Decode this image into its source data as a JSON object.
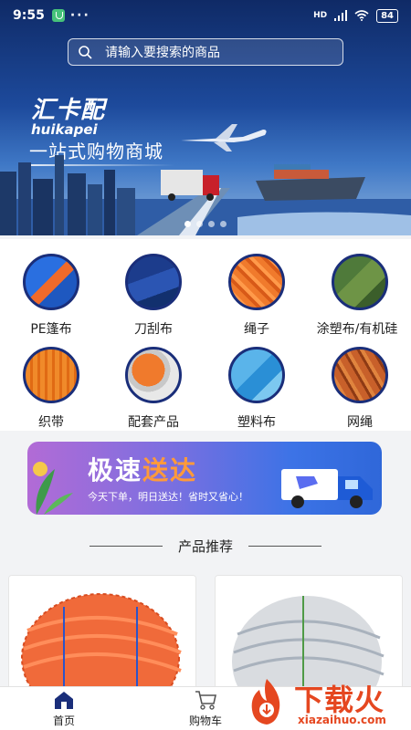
{
  "status_bar": {
    "time": "9:55",
    "dots": "···",
    "network": "HD",
    "battery": "84"
  },
  "search": {
    "placeholder": "请输入要搜索的商品"
  },
  "banner": {
    "logo_cn": "汇卡配",
    "logo_en": "huikapei",
    "slogan": "一站式购物商城",
    "page_count": 4,
    "active_page": 1
  },
  "categories": [
    {
      "label": "PE篷布",
      "icon": "pe-tarp-icon"
    },
    {
      "label": "刀刮布",
      "icon": "knife-coated-fabric-icon"
    },
    {
      "label": "绳子",
      "icon": "rope-icon"
    },
    {
      "label": "涂塑布/有机硅",
      "icon": "coated-fabric-icon"
    },
    {
      "label": "织带",
      "icon": "webbing-icon"
    },
    {
      "label": "配套产品",
      "icon": "accessories-icon"
    },
    {
      "label": "塑料布",
      "icon": "plastic-sheet-icon"
    },
    {
      "label": "网绳",
      "icon": "net-rope-icon"
    }
  ],
  "promo": {
    "title_a": "极速",
    "title_b": "送达",
    "subtitle": "今天下单，明日送达！省时又省心！"
  },
  "section": {
    "title": "产品推荐"
  },
  "products": [
    {
      "image": "orange-rope-coil"
    },
    {
      "image": "white-rope-coil"
    }
  ],
  "bottom_nav": {
    "home": "首页",
    "cart": "购物车"
  },
  "watermark": {
    "cn": "下载火",
    "en": "xiazaihuo.com"
  },
  "colors": {
    "accent_navy": "#1a2e7a",
    "watermark": "#e54720",
    "promo_orange": "#ff9a3a"
  }
}
